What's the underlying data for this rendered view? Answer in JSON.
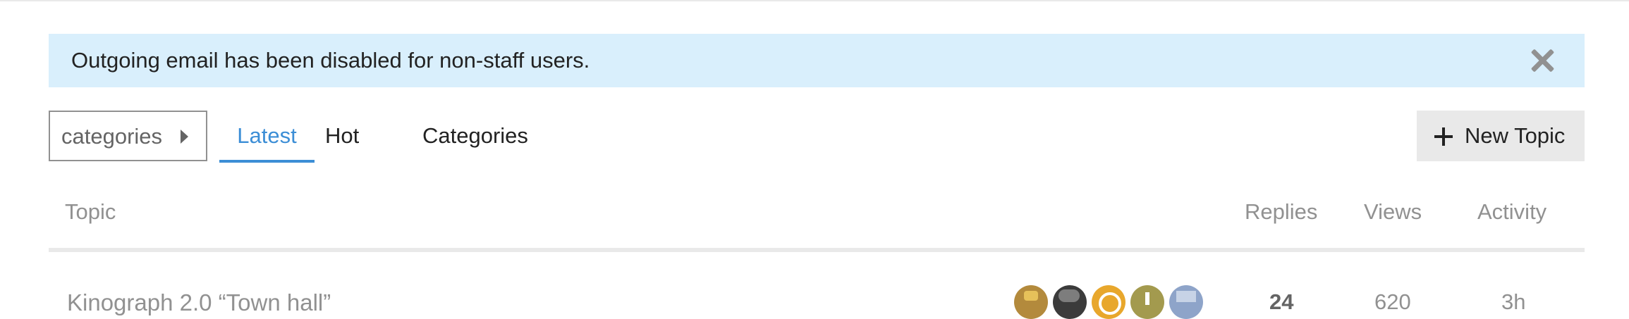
{
  "alert": {
    "message": "Outgoing email has been disabled for non-staff users.",
    "close_icon": "close-icon"
  },
  "nav": {
    "category_dropdown_label": "categories",
    "caret_icon": "caret-right-icon",
    "tabs": [
      {
        "label": "Latest",
        "active": true
      },
      {
        "label": "Hot",
        "active": false
      },
      {
        "label": "Categories",
        "active": false
      }
    ],
    "new_topic_label": "New Topic",
    "new_topic_icon": "plus-icon"
  },
  "table": {
    "headers": {
      "topic": "Topic",
      "replies": "Replies",
      "views": "Views",
      "activity": "Activity"
    },
    "rows": [
      {
        "title": "Kinograph 2.0 “Town hall”",
        "posters": [
          "avatar",
          "avatar",
          "avatar",
          "avatar",
          "avatar"
        ],
        "replies": "24",
        "views": "620",
        "activity": "3h"
      }
    ]
  },
  "colors": {
    "accent": "#3c8ed6",
    "alert_background": "#d9effc",
    "muted_text": "#919191",
    "button_background": "#e9e9e9"
  }
}
